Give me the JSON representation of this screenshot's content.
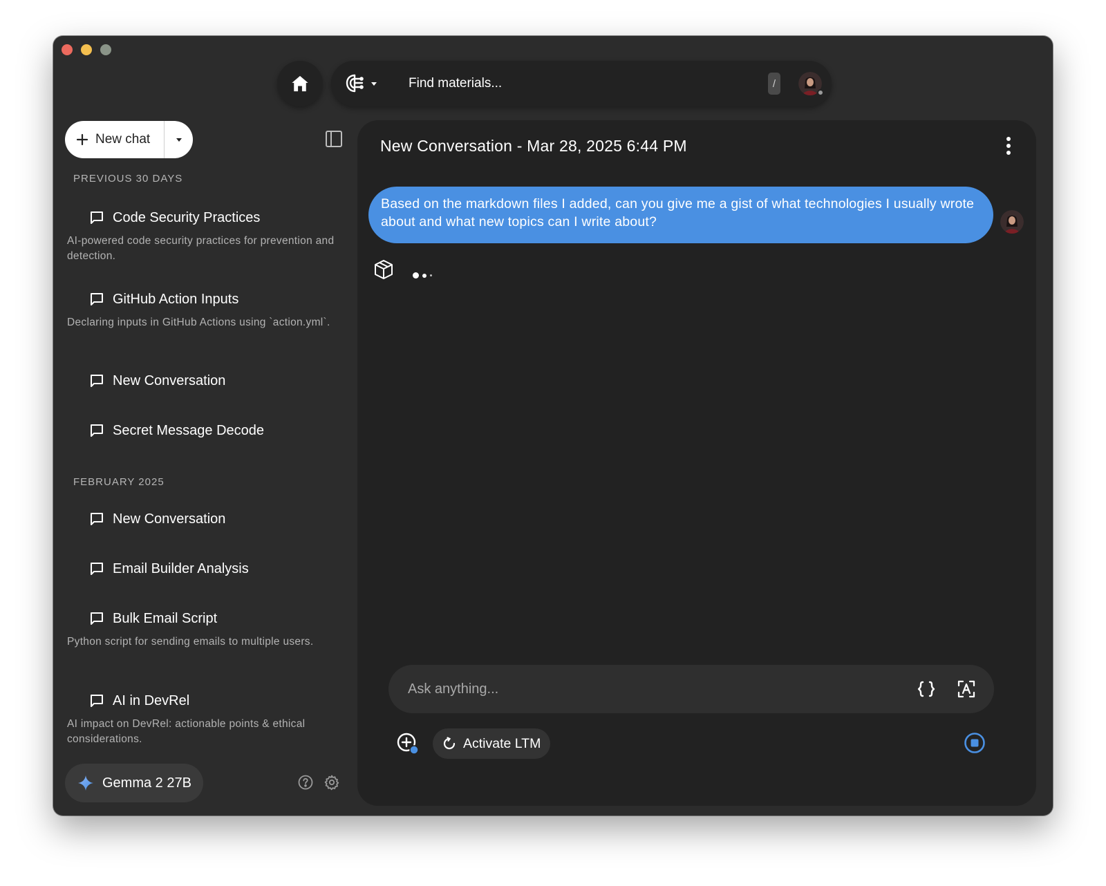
{
  "topbar": {
    "search_placeholder": "Find materials...",
    "shortcut_key": "/"
  },
  "sidebar": {
    "new_chat_label": "New chat",
    "sections": [
      {
        "label": "PREVIOUS 30 DAYS",
        "items": [
          {
            "title": "Code Security Practices",
            "description": "AI-powered code security practices for prevention and detection."
          },
          {
            "title": "GitHub Action Inputs",
            "description": "Declaring inputs in GitHub Actions using `action.yml`."
          },
          {
            "title": "New Conversation",
            "description": ""
          },
          {
            "title": "Secret Message Decode",
            "description": ""
          }
        ]
      },
      {
        "label": "FEBRUARY 2025",
        "items": [
          {
            "title": "New Conversation",
            "description": ""
          },
          {
            "title": "Email Builder Analysis",
            "description": ""
          },
          {
            "title": "Bulk Email Script",
            "description": "Python script for sending emails to multiple users."
          },
          {
            "title": "AI in DevRel",
            "description": "AI impact on DevRel: actionable points & ethical considerations."
          }
        ]
      }
    ],
    "model_name": "Gemma 2 27B"
  },
  "conversation": {
    "title": "New Conversation - Mar 28, 2025 6:44 PM",
    "messages": [
      {
        "role": "user",
        "text": "Based on the markdown files I added, can you give me a gist of what technologies I usually wrote about and what new topics can I write about?"
      }
    ]
  },
  "composer": {
    "placeholder": "Ask anything...",
    "ltm_label": "Activate LTM"
  },
  "colors": {
    "accent": "#4a90e2",
    "window_bg": "#2c2c2c",
    "panel_bg": "#222222"
  },
  "icons": [
    "home-icon",
    "copilot-source-icon",
    "plus-icon",
    "chevron-down-icon",
    "sidebar-toggle-icon",
    "chat-bubble-icon",
    "sparkle-icon",
    "help-icon",
    "gear-icon",
    "more-vertical-icon",
    "bot-box-icon",
    "code-braces-icon",
    "text-scan-icon",
    "add-context-icon",
    "refresh-icon",
    "stop-icon"
  ]
}
